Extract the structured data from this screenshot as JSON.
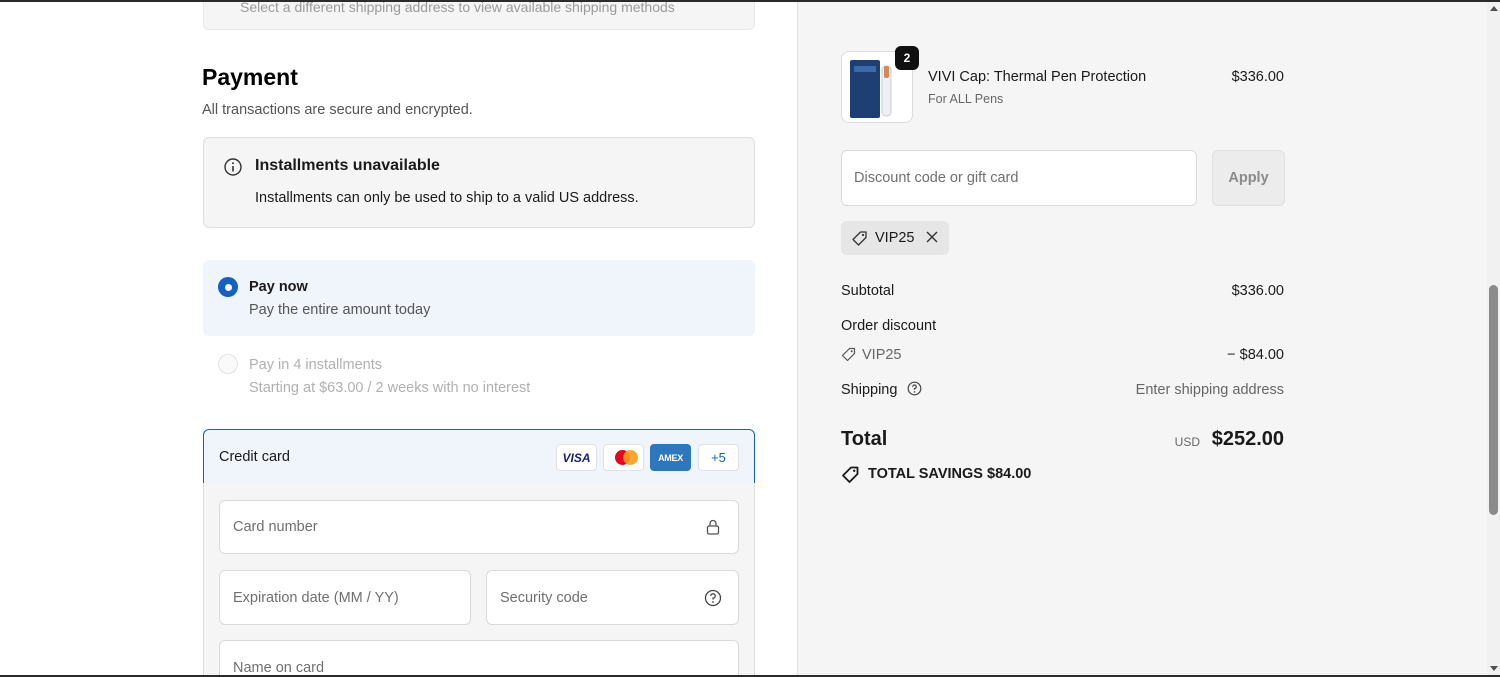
{
  "shipping_notice": "Select a different shipping address to view available shipping methods",
  "payment": {
    "title": "Payment",
    "subtitle": "All transactions are secure and encrypted.",
    "installments_notice": {
      "title": "Installments unavailable",
      "text": "Installments can only be used to ship to a valid US address."
    },
    "options": [
      {
        "title": "Pay now",
        "subtitle": "Pay the entire amount today",
        "selected": true
      },
      {
        "title": "Pay in 4 installments",
        "subtitle": "Starting at $63.00 / 2 weeks with no interest",
        "selected": false
      }
    ],
    "credit_card": {
      "label": "Credit card",
      "brands": [
        "VISA",
        "Mastercard",
        "AMEX"
      ],
      "more": "+5",
      "card_number_placeholder": "Card number",
      "expiration_placeholder": "Expiration date (MM / YY)",
      "security_placeholder": "Security code",
      "name_placeholder": "Name on card"
    }
  },
  "summary": {
    "product": {
      "quantity": "2",
      "name": "VIVI Cap: Thermal Pen Protection",
      "variant": "For ALL Pens",
      "price": "$336.00"
    },
    "discount_placeholder": "Discount code or gift card",
    "apply_label": "Apply",
    "applied_code": "VIP25",
    "subtotal_label": "Subtotal",
    "subtotal_value": "$336.00",
    "order_discount_label": "Order discount",
    "discount_code": "VIP25",
    "discount_value": "− $84.00",
    "shipping_label": "Shipping",
    "shipping_value": "Enter shipping address",
    "total_label": "Total",
    "currency": "USD",
    "total_value": "$252.00",
    "savings_label": "TOTAL SAVINGS",
    "savings_value": "$84.00"
  },
  "colors": {
    "accent": "#1560c4",
    "summary_bg": "#f5f5f5"
  }
}
